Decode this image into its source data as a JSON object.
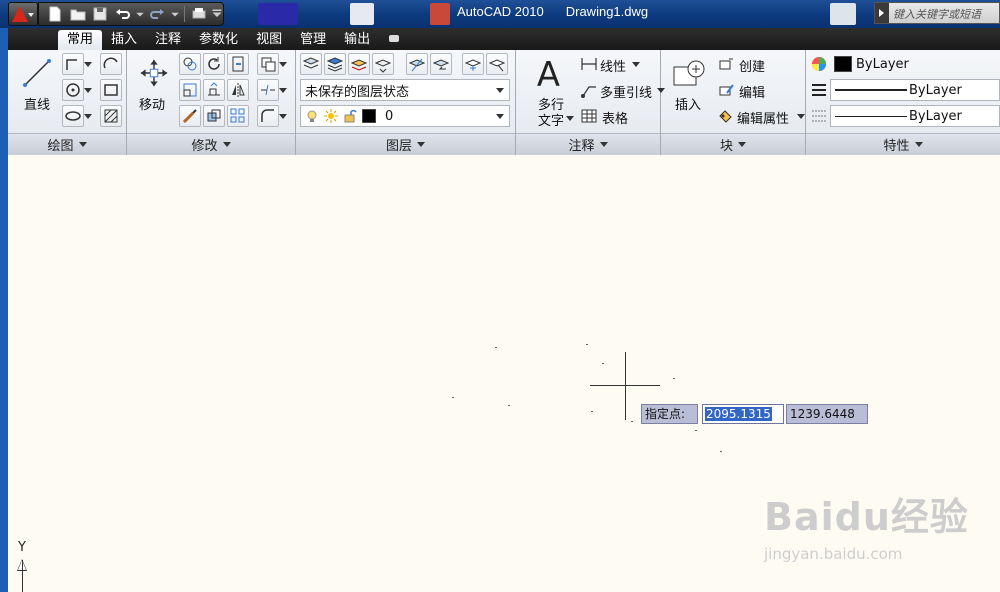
{
  "window": {
    "app_title": "AutoCAD 2010",
    "document": "Drawing1.dwg",
    "search_placeholder": "键入关键字或短语"
  },
  "ribbon": {
    "tabs": [
      "常用",
      "插入",
      "注释",
      "参数化",
      "视图",
      "管理",
      "输出"
    ],
    "active_tab": "常用",
    "panels": {
      "draw": {
        "title": "绘图",
        "line_label": "直线"
      },
      "modify": {
        "title": "修改",
        "move_label": "移动"
      },
      "layers": {
        "title": "图层",
        "layer_state": "未保存的图层状态",
        "current_layer": "0"
      },
      "annotation": {
        "title": "注释",
        "mtext_label_1": "多行",
        "mtext_label_2": "文字",
        "linear_label": "线性",
        "mleader_label": "多重引线",
        "table_label": "表格"
      },
      "block": {
        "title": "块",
        "insert_label": "插入",
        "create_label": "创建",
        "edit_label": "编辑",
        "edit_attr_label": "编辑属性"
      },
      "properties": {
        "title": "特性",
        "color": "ByLayer",
        "linetype": "ByLayer",
        "lineweight": "ByLayer"
      }
    }
  },
  "drawing": {
    "prompt_label": "指定点:",
    "coord_x": "2095.1315",
    "coord_y": "1239.6448",
    "ucs_y_label": "Y",
    "background_color": "#fefcf2"
  },
  "watermark": {
    "brand": "Baidu经验",
    "url": "jingyan.baidu.com"
  },
  "icons": [
    "autocad-logo-icon",
    "new-icon",
    "open-icon",
    "save-icon",
    "undo-icon",
    "redo-icon",
    "plot-icon",
    "line-icon",
    "move-icon",
    "insert-block-icon",
    "mtext-icon",
    "ucs-icon"
  ]
}
